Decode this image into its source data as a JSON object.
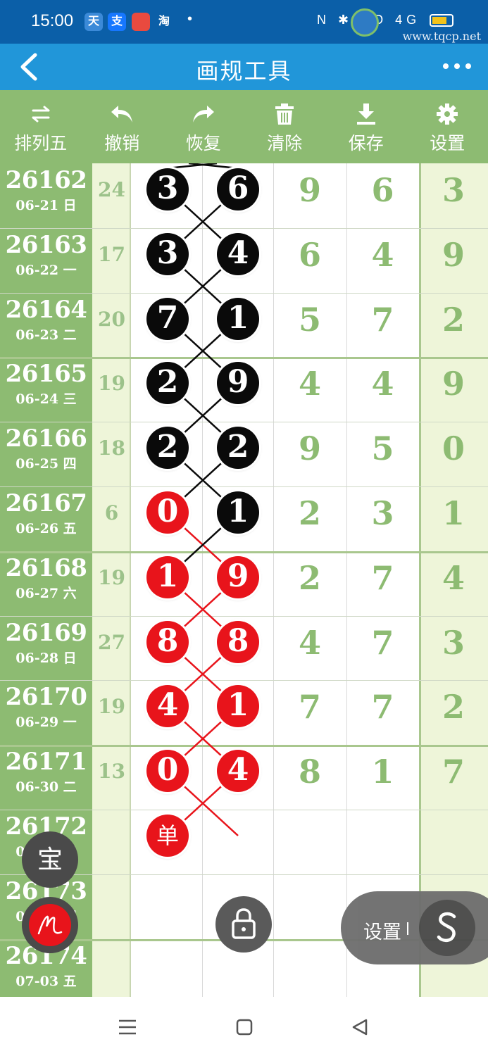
{
  "status_bar": {
    "time": "15:00",
    "apps": [
      "天",
      "支",
      "淘"
    ],
    "dot": "•",
    "system_icons": "N ✱ HD 4G",
    "watermark": "www.tqcp.net"
  },
  "header": {
    "title": "画规工具",
    "back_icon": "chevron-left-icon",
    "more_icon": "more-dots-icon"
  },
  "toolbar": {
    "items": [
      {
        "label": "排列五",
        "icon": "swap-icon"
      },
      {
        "label": "撤销",
        "icon": "undo-icon"
      },
      {
        "label": "恢复",
        "icon": "redo-icon"
      },
      {
        "label": "清除",
        "icon": "trash-icon"
      },
      {
        "label": "保存",
        "icon": "download-icon"
      },
      {
        "label": "设置",
        "icon": "gear-icon"
      }
    ]
  },
  "grid": {
    "rows": [
      {
        "issue": "26162",
        "date": "06-21 日",
        "sum": "24",
        "b1": "3",
        "b2": "6",
        "d3": "9",
        "d4": "6",
        "d5": "3"
      },
      {
        "issue": "26163",
        "date": "06-22 一",
        "sum": "17",
        "b1": "3",
        "b2": "4",
        "d3": "6",
        "d4": "4",
        "d5": "9"
      },
      {
        "issue": "26164",
        "date": "06-23 二",
        "sum": "20",
        "b1": "7",
        "b2": "1",
        "d3": "5",
        "d4": "7",
        "d5": "2"
      },
      {
        "issue": "26165",
        "date": "06-24 三",
        "sum": "19",
        "b1": "2",
        "b2": "9",
        "d3": "4",
        "d4": "4",
        "d5": "9"
      },
      {
        "issue": "26166",
        "date": "06-25 四",
        "sum": "18",
        "b1": "2",
        "b2": "2",
        "d3": "9",
        "d4": "5",
        "d5": "0"
      },
      {
        "issue": "26167",
        "date": "06-26 五",
        "sum": "6",
        "b1": "0",
        "b2": "1",
        "d3": "2",
        "d4": "3",
        "d5": "1"
      },
      {
        "issue": "26168",
        "date": "06-27 六",
        "sum": "19",
        "b1": "1",
        "b2": "9",
        "d3": "2",
        "d4": "7",
        "d5": "4"
      },
      {
        "issue": "26169",
        "date": "06-28 日",
        "sum": "27",
        "b1": "8",
        "b2": "8",
        "d3": "4",
        "d4": "7",
        "d5": "3"
      },
      {
        "issue": "26170",
        "date": "06-29 一",
        "sum": "19",
        "b1": "4",
        "b2": "1",
        "d3": "7",
        "d4": "7",
        "d5": "2"
      },
      {
        "issue": "26171",
        "date": "06-30 二",
        "sum": "13",
        "b1": "0",
        "b2": "4",
        "d3": "8",
        "d4": "1",
        "d5": "7"
      },
      {
        "issue": "26172",
        "date": "07-01 三",
        "sum": "",
        "b1": "单",
        "b2": "",
        "d3": "",
        "d4": "",
        "d5": ""
      },
      {
        "issue": "26173",
        "date": "07-02 四",
        "sum": "",
        "b1": "",
        "b2": "",
        "d3": "",
        "d4": "",
        "d5": ""
      },
      {
        "issue": "26174",
        "date": "07-03 五",
        "sum": "",
        "b1": "",
        "b2": "",
        "d3": "",
        "d4": "",
        "d5": ""
      }
    ],
    "ball_colors": {
      "black": "#0a0a0a",
      "red": "#e8141b"
    }
  },
  "floating": {
    "bao_label": "宝",
    "pen_icon": "pen-icon",
    "lock_icon": "lock-icon",
    "settings_label": "设置",
    "s_icon": "s-logo-icon"
  },
  "navbar": {
    "icons": [
      "menu-icon",
      "home-square-icon",
      "back-triangle-icon"
    ]
  }
}
